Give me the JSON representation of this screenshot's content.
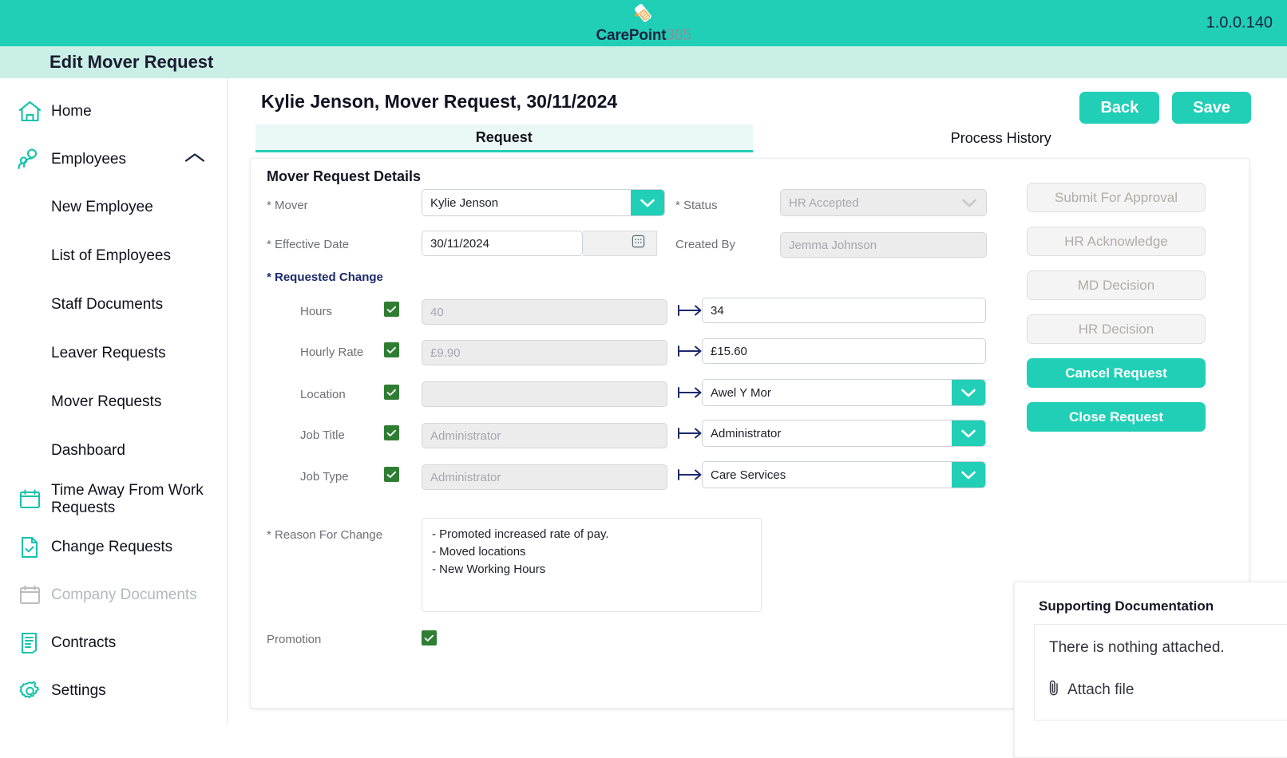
{
  "app": {
    "logo_primary": "CarePoint",
    "logo_secondary": "365",
    "version": "1.0.0.140",
    "page_title": "Edit Mover Request",
    "accent": "#21cfb7",
    "band": "#c9efe6",
    "check_green": "#2f7d32",
    "arrow_navy": "#1b2a6b"
  },
  "sidebar": {
    "items": [
      {
        "label": "Home",
        "icon": "home-icon",
        "level": "top",
        "disabled": false
      },
      {
        "label": "Employees",
        "icon": "employees-icon",
        "level": "top",
        "disabled": false,
        "expanded": true,
        "chevron": "chevron-up-icon"
      },
      {
        "label": "New Employee",
        "icon": "",
        "level": "sub",
        "disabled": false
      },
      {
        "label": "List of Employees",
        "icon": "",
        "level": "sub",
        "disabled": false
      },
      {
        "label": "Staff Documents",
        "icon": "",
        "level": "sub",
        "disabled": false
      },
      {
        "label": "Leaver Requests",
        "icon": "",
        "level": "sub",
        "disabled": false
      },
      {
        "label": "Mover Requests",
        "icon": "",
        "level": "sub",
        "disabled": false
      },
      {
        "label": "Dashboard",
        "icon": "",
        "level": "sub",
        "disabled": false
      },
      {
        "label": "Time Away From Work Requests",
        "icon": "calendar-icon",
        "level": "top",
        "disabled": false
      },
      {
        "label": "Change Requests",
        "icon": "document-check-icon",
        "level": "top",
        "disabled": false
      },
      {
        "label": "Company Documents",
        "icon": "calendar-blank-icon",
        "level": "top",
        "disabled": true
      },
      {
        "label": "Contracts",
        "icon": "contract-icon",
        "level": "top",
        "disabled": false
      },
      {
        "label": "Settings",
        "icon": "gear-icon",
        "level": "top",
        "disabled": false
      }
    ]
  },
  "main": {
    "record_title": "Kylie Jenson, Mover Request, 30/11/2024",
    "back_label": "Back",
    "save_label": "Save",
    "tabs": [
      {
        "label": "Request",
        "active": true
      },
      {
        "label": "Process History",
        "active": false
      }
    ],
    "card_title": "Mover Request Details",
    "fields": {
      "mover_label": "* Mover",
      "mover_value": "Kylie Jenson",
      "effective_date_label": "* Effective Date",
      "effective_date_value": "30/11/2024",
      "status_label": "* Status",
      "status_value": "HR Accepted",
      "created_by_label": "Created By",
      "created_by_value": "Jemma Johnson"
    },
    "requested_change_label": "* Requested Change",
    "changes": [
      {
        "label": "Hours",
        "checked": true,
        "from": "40",
        "to": "34",
        "to_type": "text"
      },
      {
        "label": "Hourly Rate",
        "checked": true,
        "from": "£9.90",
        "to": "£15.60",
        "to_type": "text"
      },
      {
        "label": "Location",
        "checked": true,
        "from": "",
        "to": "Awel Y Mor",
        "to_type": "select"
      },
      {
        "label": "Job Title",
        "checked": true,
        "from": "Administrator",
        "to": "Administrator",
        "to_type": "select"
      },
      {
        "label": "Job Type",
        "checked": true,
        "from": "Administrator",
        "to": "Care Services",
        "to_type": "select"
      }
    ],
    "reason_label": "* Reason For Change",
    "reason_value": "- Promoted increased rate of pay.\n- Moved locations\n- New Working Hours",
    "promotion_label": "Promotion",
    "promotion_checked": true,
    "actions": [
      {
        "label": "Submit For Approval",
        "state": "disabled"
      },
      {
        "label": "HR Acknowledge",
        "state": "disabled"
      },
      {
        "label": "MD Decision",
        "state": "disabled"
      },
      {
        "label": "HR Decision",
        "state": "disabled"
      },
      {
        "label": "Cancel Request",
        "state": "active"
      },
      {
        "label": "Close Request",
        "state": "active"
      }
    ],
    "supporting": {
      "title": "Supporting Documentation",
      "empty_text": "There is nothing attached.",
      "attach_label": "Attach file",
      "attach_icon": "paperclip-icon"
    }
  }
}
